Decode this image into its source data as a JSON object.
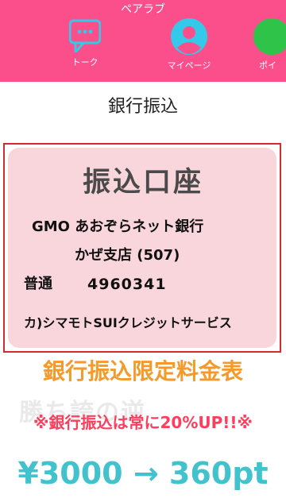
{
  "header": {
    "app_title": "ペアラブ",
    "bg_color": "#fb4f8c",
    "nav": [
      {
        "label": "トーク",
        "icon": "chat-bubble-icon",
        "color": "#34c9e8"
      },
      {
        "label": "マイページ",
        "icon": "user-icon",
        "color": "#34c9e8"
      },
      {
        "label": "ポイ",
        "icon": "point-icon",
        "color": "#2fc34a"
      }
    ]
  },
  "page": {
    "title": "銀行振込"
  },
  "account": {
    "heading": "振込口座",
    "bank": "GMO あおぞらネット銀行",
    "branch": "かぜ支店 (507)",
    "type": "普通",
    "number": "4960341",
    "holder": "カ)シマモトSUIクレジットサービス"
  },
  "pricing": {
    "heading": "銀行振込限定料金表",
    "watermark": "勝ち誇の逆",
    "note": "※銀行振込は常に20%UP!!※",
    "price": "¥3000 → 360pt",
    "heading_color": "#f59a2a",
    "note_color": "#ff3d5c",
    "price_color": "#41c2cc"
  }
}
